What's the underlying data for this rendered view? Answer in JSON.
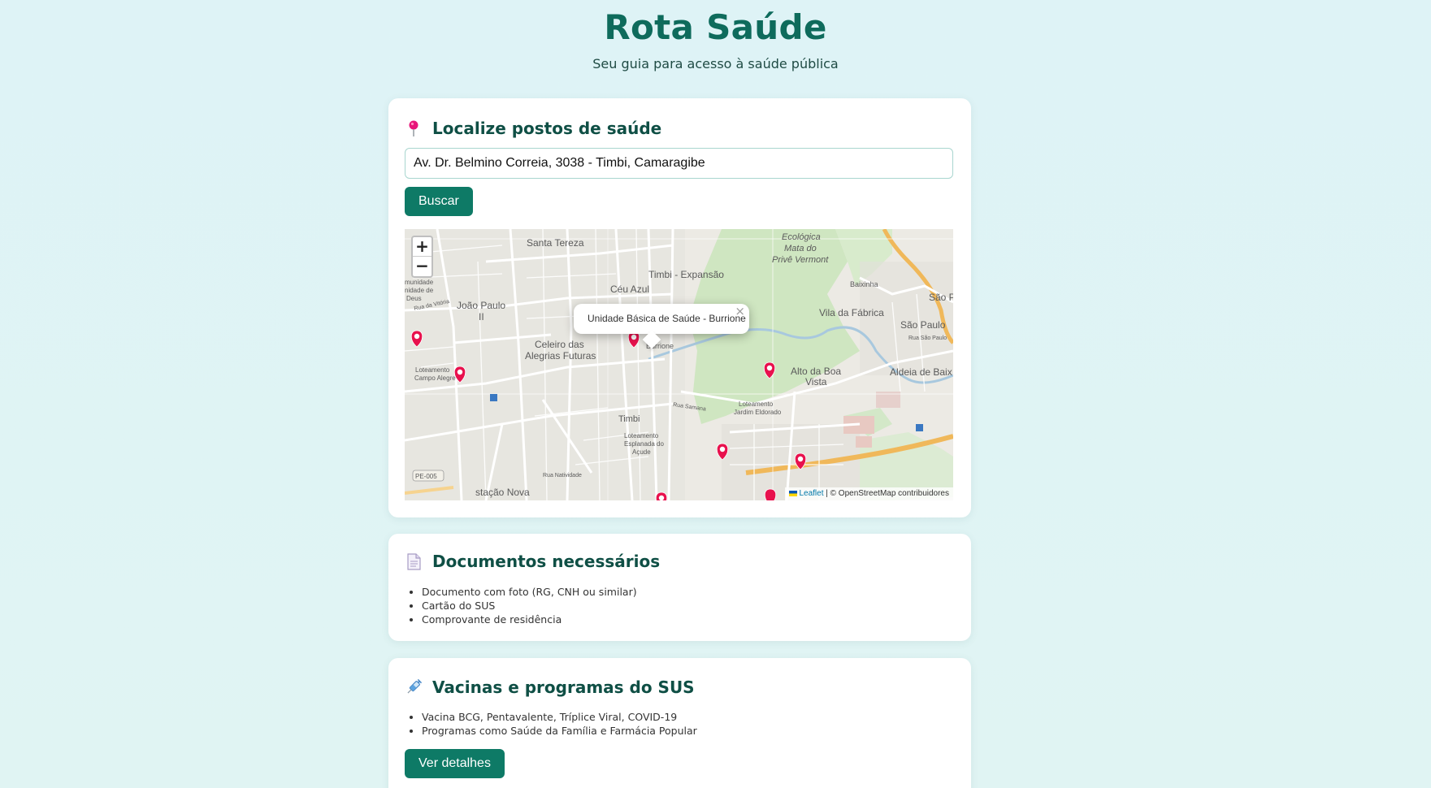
{
  "header": {
    "title": "Rota Saúde",
    "subtitle": "Seu guia para acesso à saúde pública"
  },
  "locator": {
    "title": "Localize postos de saúde",
    "icon": "pin-icon",
    "address_value": "Av. Dr. Belmino Correia, 3038 - Timbi, Camaragibe",
    "search_label": "Buscar",
    "map": {
      "zoom_in": "+",
      "zoom_out": "−",
      "popup_text": "Unidade Básica de Saúde - Burrione",
      "popup_close": "×",
      "attribution_leaflet": "Leaflet",
      "attribution_rest": " | © OpenStreetMap contribuidores",
      "labels": {
        "santa_tereza": "Santa Tereza",
        "timbi_expansao": "Timbi - Expansão",
        "ceu_azul": "Céu Azul",
        "ecologica": "Ecológica",
        "mata_do": "Mata do",
        "prive_vermont": "Privê Vermont",
        "baixinha": "Baixinha",
        "sao_p": "São P",
        "sao_paulo": "São Paulo",
        "vila_da_fabrica": "Vila da Fábrica",
        "aldeia_de_baix": "Aldeia de Baix",
        "joao_paulo": "João Paulo",
        "ii": "II",
        "celeiro_das": "Celeiro das",
        "alegrias_futuras": "Alegrias Futuras",
        "burrione": "Burrione",
        "alto_boa": "Alto da Boa",
        "vista": "Vista",
        "loteamento": "Loteamento",
        "campo_alegre": "Campo Alegre",
        "timbi": "Timbi",
        "loteamento2": "Loteamento",
        "jardim_eldorado": "Jardim Eldorado",
        "loteamento3": "Loteamento",
        "esplanada": "Esplanada do",
        "acude": "Açude",
        "estacao_nova": "stação Nova",
        "pe005": "PE-005",
        "munidade": "munidade",
        "unidade_de": "nidade de",
        "deus": "Deus",
        "rua_da_vitoria": "Rua da Vitória",
        "rua_samana": "Rua Samana",
        "rua_sao_paulo": "Rua São Paulo",
        "rua_natividade": "Rua Natividade"
      },
      "marker_icon": "map-marker-icon"
    }
  },
  "documents": {
    "title": "Documentos necessários",
    "icon": "document-icon",
    "items": [
      "Documento com foto (RG, CNH ou similar)",
      "Cartão do SUS",
      "Comprovante de residência"
    ]
  },
  "vaccines": {
    "title": "Vacinas e programas do SUS",
    "icon": "syringe-icon",
    "items": [
      "Vacina BCG, Pentavalente, Tríplice Viral, COVID-19",
      "Programas como Saúde da Família e Farmácia Popular"
    ],
    "details_label": "Ver detalhes"
  },
  "colors": {
    "brand": "#0e6b5c",
    "button": "#0e7a66",
    "marker": "#e8114d"
  }
}
